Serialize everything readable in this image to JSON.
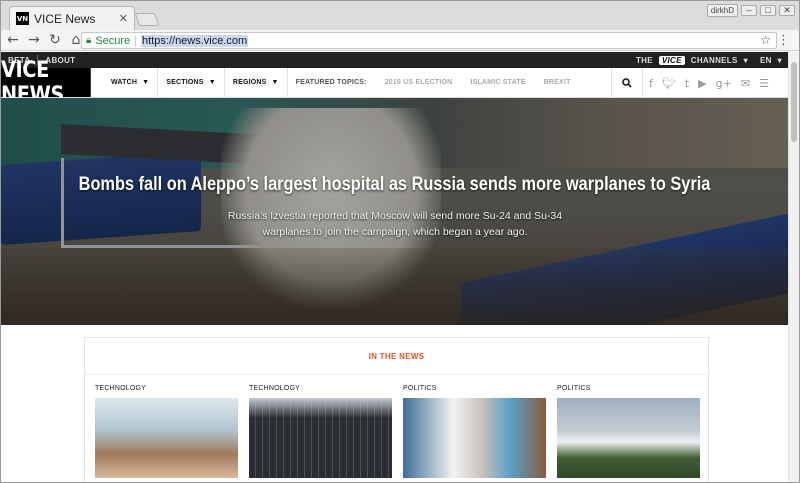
{
  "browser": {
    "tab_title": "VICE News",
    "favicon_text": "VN",
    "user_label": "dirkhD",
    "secure_label": "Secure",
    "url": "https://news.vice.com"
  },
  "topstrip": {
    "beta": "BETA",
    "about": "ABOUT",
    "the": "THE",
    "vice": "VICE",
    "channels": "CHANNELS",
    "lang": "EN"
  },
  "nav": {
    "logo": "VICE NEWS",
    "watch": "WATCH",
    "sections": "SECTIONS",
    "regions": "REGIONS",
    "featured_label": "FEATURED TOPICS:",
    "topics": [
      "2016 US ELECTION",
      "ISLAMIC STATE",
      "BREXIT"
    ]
  },
  "hero": {
    "headline": "Bombs fall on Aleppo’s largest hospital as Russia sends more warplanes to Syria",
    "summary": "Russia’s Izvestia reported that Moscow will send more Su-24 and Su-34 warplanes to join the campaign, which began a year ago."
  },
  "in_the_news": {
    "heading": "IN THE NEWS",
    "cards": [
      {
        "category": "TECHNOLOGY"
      },
      {
        "category": "TECHNOLOGY"
      },
      {
        "category": "POLITICS"
      },
      {
        "category": "POLITICS"
      }
    ]
  },
  "colors": {
    "accent": "#e8531e",
    "secure_green": "#1e8e3e",
    "topbar": "#212121"
  }
}
